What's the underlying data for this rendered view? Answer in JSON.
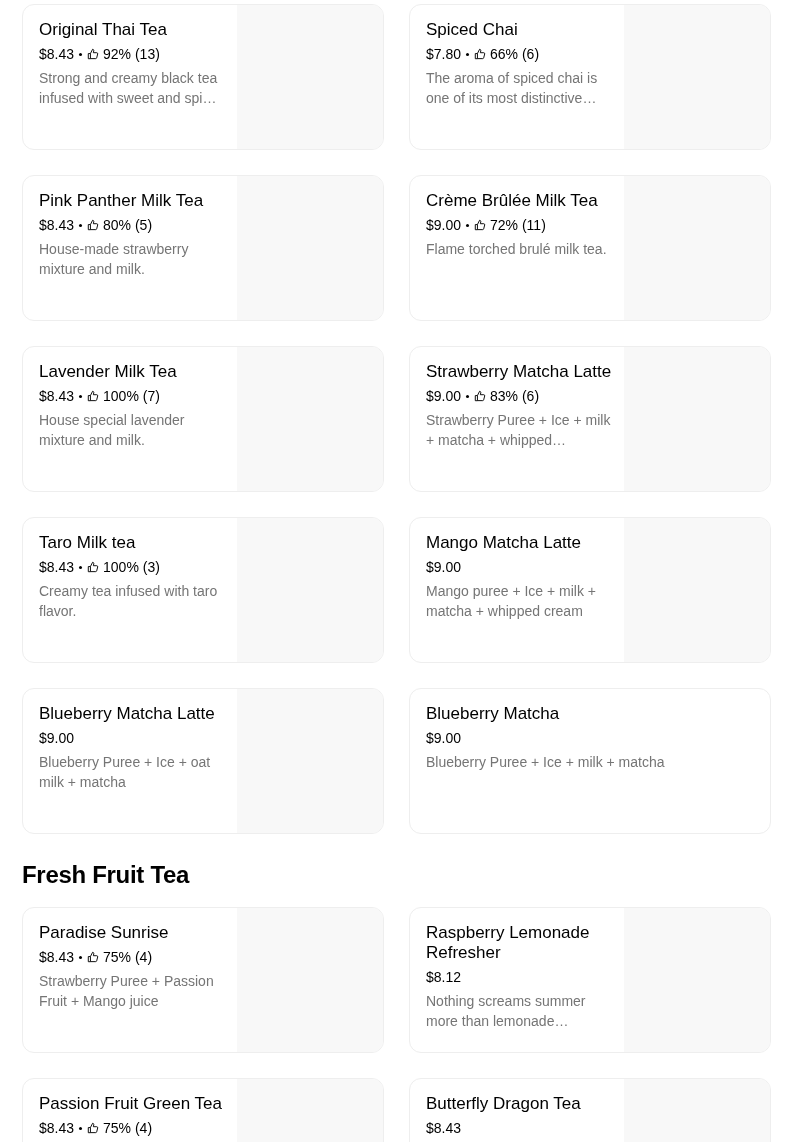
{
  "sections": [
    {
      "items": [
        {
          "name": "Original Thai Tea",
          "price": "$8.43",
          "rating": "92% (13)",
          "description": "Strong and creamy black tea infused with sweet and spi…",
          "has_image": true
        },
        {
          "name": "Spiced Chai",
          "price": "$7.80",
          "rating": "66% (6)",
          "description": "The aroma of spiced chai is one of its most distinctive…",
          "has_image": true
        },
        {
          "name": "Pink Panther Milk Tea",
          "price": "$8.43",
          "rating": "80% (5)",
          "description": "House-made strawberry mixture and milk.",
          "has_image": true
        },
        {
          "name": "Crème Brûlée Milk Tea",
          "price": "$9.00",
          "rating": "72% (11)",
          "description": "Flame torched brulé milk tea.",
          "has_image": true
        },
        {
          "name": "Lavender Milk Tea",
          "price": "$8.43",
          "rating": "100% (7)",
          "description": "House special lavender mixture and milk.",
          "has_image": true
        },
        {
          "name": "Strawberry Matcha Latte",
          "price": "$9.00",
          "rating": "83% (6)",
          "description": "Strawberry Puree + Ice + milk + matcha + whipped…",
          "has_image": true
        },
        {
          "name": "Taro Milk tea",
          "price": "$8.43",
          "rating": "100% (3)",
          "description": "Creamy tea infused with taro flavor.",
          "has_image": true
        },
        {
          "name": "Mango Matcha Latte",
          "price": "$9.00",
          "description": "Mango puree + Ice + milk + matcha + whipped cream",
          "has_image": true
        },
        {
          "name": "Blueberry Matcha Latte",
          "price": "$9.00",
          "description": "Blueberry Puree + Ice + oat milk + matcha",
          "has_image": true
        },
        {
          "name": "Blueberry Matcha",
          "price": "$9.00",
          "description": "Blueberry Puree + Ice + milk + matcha",
          "has_image": false
        }
      ]
    },
    {
      "title": "Fresh Fruit Tea",
      "items": [
        {
          "name": "Paradise Sunrise",
          "price": "$8.43",
          "rating": "75% (4)",
          "description": "Strawberry Puree + Passion Fruit + Mango juice",
          "has_image": true
        },
        {
          "name": "Raspberry Lemonade Refresher",
          "price": "$8.12",
          "description": "Nothing screams summer more than lemonade…",
          "has_image": true
        },
        {
          "name": "Passion Fruit Green Tea",
          "price": "$8.43",
          "rating": "75% (4)",
          "has_image": true
        },
        {
          "name": "Butterfly Dragon Tea",
          "price": "$8.43",
          "has_image": true
        }
      ]
    }
  ]
}
